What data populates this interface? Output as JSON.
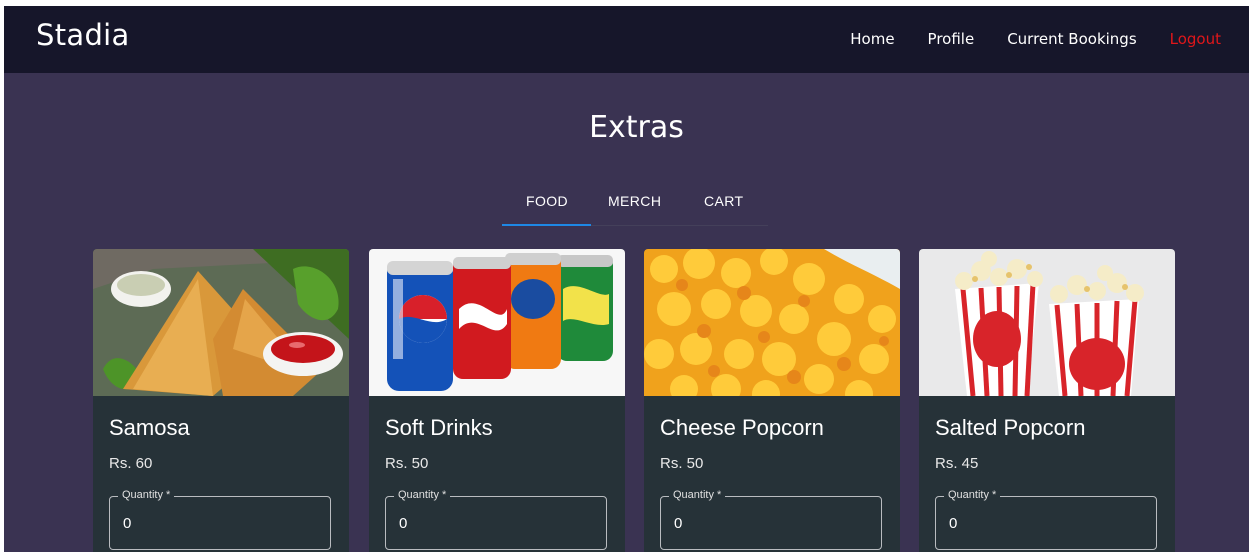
{
  "navbar": {
    "brand": "Stadia",
    "links": {
      "home": "Home",
      "profile": "Profile",
      "bookings": "Current Bookings",
      "logout": "Logout"
    },
    "logout_color": "#e0161a"
  },
  "page": {
    "title": "Extras"
  },
  "tabs": {
    "active": "FOOD",
    "items": [
      "FOOD",
      "MERCH",
      "CART"
    ],
    "indicator_color": "#1e88e5"
  },
  "products": [
    {
      "name": "Samosa",
      "price": "Rs. 60",
      "quantity_label": "Quantity *",
      "quantity": "0",
      "image": "samosa-photo"
    },
    {
      "name": "Soft Drinks",
      "price": "Rs. 50",
      "quantity_label": "Quantity *",
      "quantity": "0",
      "image": "soda-cans-photo"
    },
    {
      "name": "Cheese Popcorn",
      "price": "Rs. 50",
      "quantity_label": "Quantity *",
      "quantity": "0",
      "image": "cheese-popcorn-photo"
    },
    {
      "name": "Salted Popcorn",
      "price": "Rs. 45",
      "quantity_label": "Quantity *",
      "quantity": "0",
      "image": "popcorn-box-photo"
    }
  ]
}
